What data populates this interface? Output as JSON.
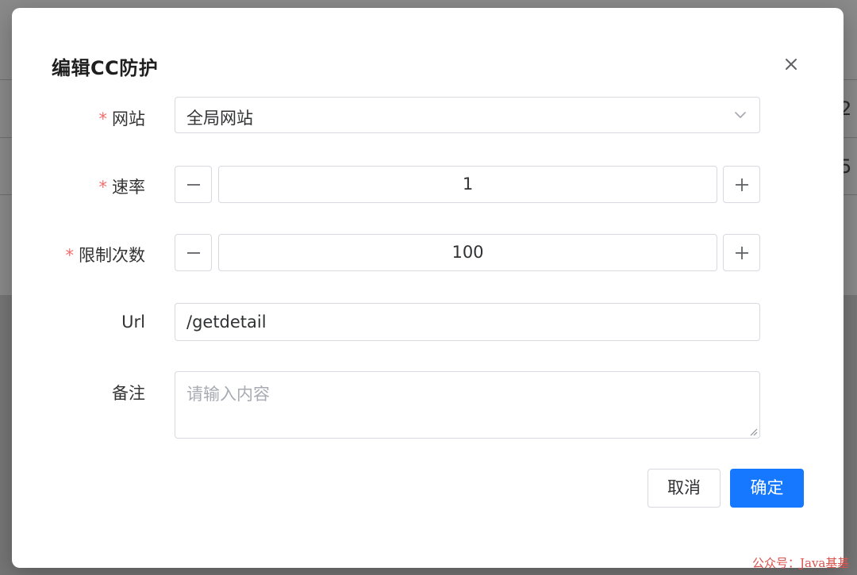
{
  "background": {
    "row_fragments": [
      "2 (",
      "5 "
    ]
  },
  "dialog": {
    "title": "编辑CC防护",
    "close_icon": "close-icon"
  },
  "form": {
    "required_mark": "*",
    "website": {
      "label": "网站",
      "value": "全局网站",
      "icon": "chevron-down-icon"
    },
    "rate": {
      "label": "速率",
      "value": "1",
      "decrement_icon": "minus-icon",
      "increment_icon": "plus-icon"
    },
    "limit_count": {
      "label": "限制次数",
      "value": "100",
      "decrement_icon": "minus-icon",
      "increment_icon": "plus-icon"
    },
    "url": {
      "label": "Url",
      "value": "/getdetail"
    },
    "remark": {
      "label": "备注",
      "placeholder": "请输入内容"
    }
  },
  "footer": {
    "cancel_label": "取消",
    "confirm_label": "确定"
  },
  "watermark": "公众号：Java基基",
  "colors": {
    "primary": "#1677ff",
    "required": "#f56c6c",
    "border": "#d7d9de",
    "placeholder": "#a8abb2"
  }
}
